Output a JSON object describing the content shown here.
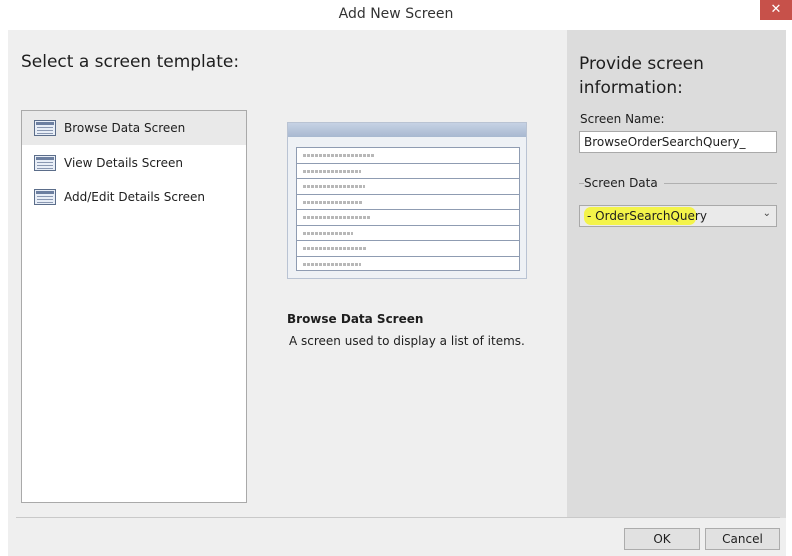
{
  "window": {
    "title": "Add New Screen",
    "close_glyph": "✕"
  },
  "left": {
    "heading": "Select a screen template:",
    "templates": [
      {
        "label": "Browse Data Screen",
        "icon": "grid-screen-icon",
        "selected": true
      },
      {
        "label": "View Details Screen",
        "icon": "details-screen-icon",
        "selected": false
      },
      {
        "label": "Add/Edit Details Screen",
        "icon": "edit-screen-icon",
        "selected": false
      }
    ]
  },
  "preview": {
    "title": "Browse Data Screen",
    "description": "A screen used to display a list of items."
  },
  "right": {
    "heading": "Provide screen information:",
    "screen_name_label": "Screen Name:",
    "screen_name_value": "BrowseOrderSearchQuery_",
    "screen_data_label": "Screen Data",
    "screen_data_value": "- OrderSearchQuery",
    "highlight_color": "#f3f34a"
  },
  "footer": {
    "ok_label": "OK",
    "cancel_label": "Cancel"
  }
}
